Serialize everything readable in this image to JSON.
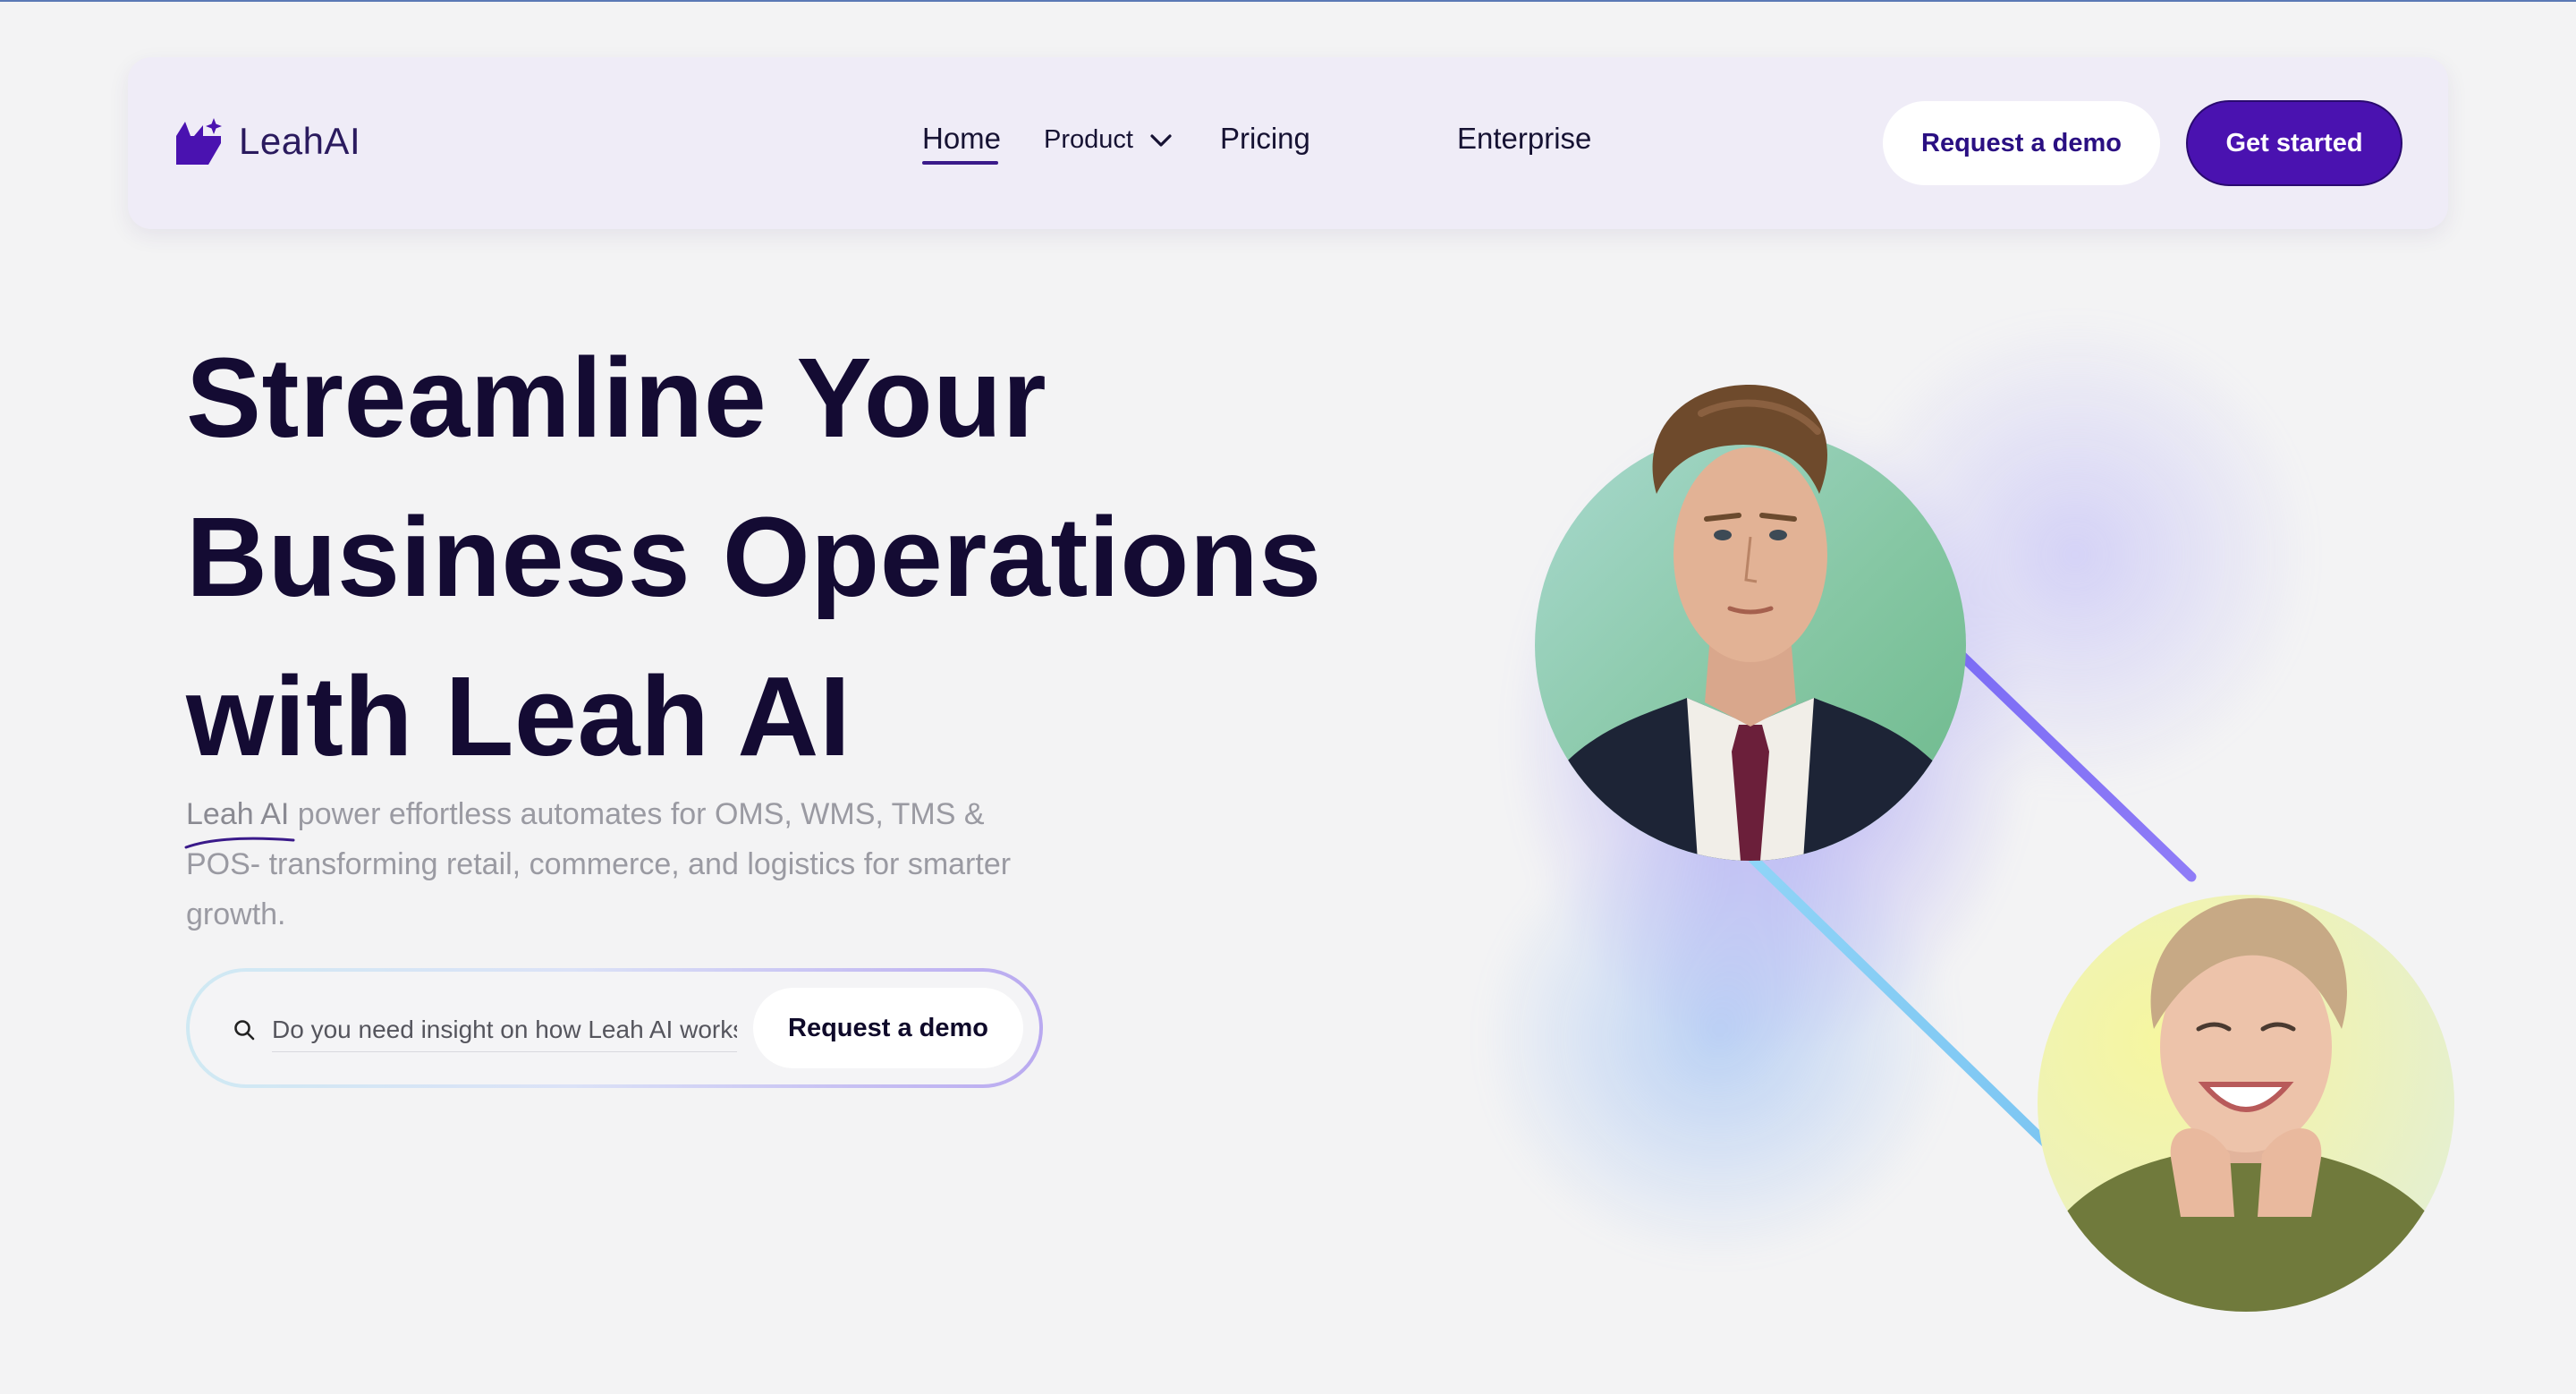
{
  "brand": {
    "name": "LeahAI",
    "accent": "#4a12b0",
    "dark": "#140b33"
  },
  "nav": {
    "links": [
      {
        "label": "Home",
        "active": true
      },
      {
        "label": "Product",
        "has_dropdown": true
      },
      {
        "label": "Pricing"
      },
      {
        "label": "Enterprise"
      }
    ],
    "request_demo_label": "Request a demo",
    "get_started_label": "Get started"
  },
  "hero": {
    "title_line1": "Streamline Your",
    "title_line2": "Business Operations",
    "title_line3": "with Leah AI",
    "subtitle_brand": "Leah AI",
    "subtitle_rest": " power effortless automates for OMS, WMS, TMS & POS- transforming retail, commerce, and logistics for smarter growth.",
    "search_placeholder": "Do you need insight on how Leah AI works",
    "search_value": "",
    "cta_label": "Request a demo"
  },
  "visual": {
    "icons": [
      "logo-icon",
      "chevron-down-icon",
      "search-icon"
    ],
    "portraits": [
      "man-portrait",
      "woman-portrait"
    ]
  }
}
